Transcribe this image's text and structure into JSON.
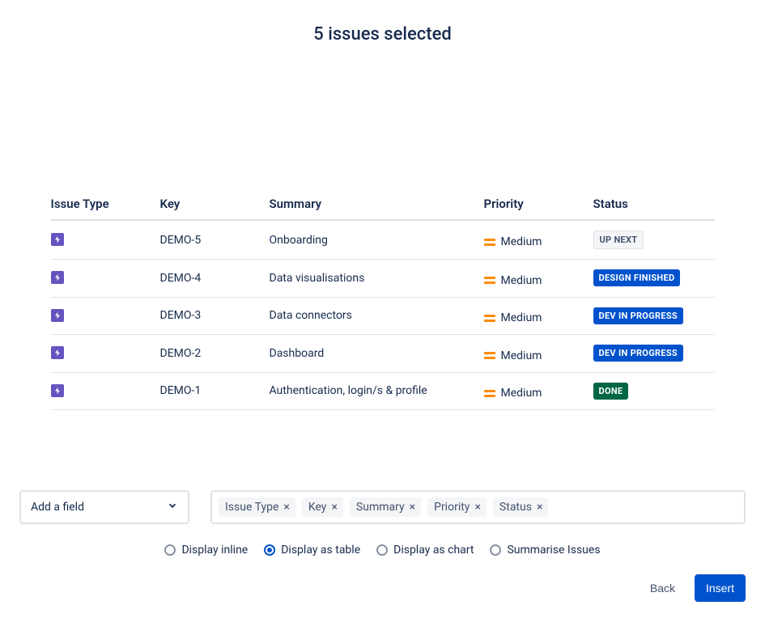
{
  "header": {
    "title": "5 issues selected"
  },
  "table": {
    "columns": {
      "issue_type": "Issue Type",
      "key": "Key",
      "summary": "Summary",
      "priority": "Priority",
      "status": "Status"
    },
    "rows": [
      {
        "type_icon": "epic-icon",
        "key": "DEMO-5",
        "summary": "Onboarding",
        "priority": "Medium",
        "status": "UP NEXT",
        "status_style": "neutral"
      },
      {
        "type_icon": "epic-icon",
        "key": "DEMO-4",
        "summary": "Data visualisations",
        "priority": "Medium",
        "status": "DESIGN FINISHED",
        "status_style": "blue"
      },
      {
        "type_icon": "epic-icon",
        "key": "DEMO-3",
        "summary": "Data connectors",
        "priority": "Medium",
        "status": "DEV IN PROGRESS",
        "status_style": "blue"
      },
      {
        "type_icon": "epic-icon",
        "key": "DEMO-2",
        "summary": "Dashboard",
        "priority": "Medium",
        "status": "DEV IN PROGRESS",
        "status_style": "blue"
      },
      {
        "type_icon": "epic-icon",
        "key": "DEMO-1",
        "summary": "Authentication, login/s & profile",
        "priority": "Medium",
        "status": "DONE",
        "status_style": "green"
      }
    ]
  },
  "add_field": {
    "label": "Add a field"
  },
  "field_chips": [
    "Issue Type",
    "Key",
    "Summary",
    "Priority",
    "Status"
  ],
  "display_options": [
    {
      "label": "Display inline",
      "selected": false
    },
    {
      "label": "Display as table",
      "selected": true
    },
    {
      "label": "Display as chart",
      "selected": false
    },
    {
      "label": "Summarise Issues",
      "selected": false
    }
  ],
  "actions": {
    "back": "Back",
    "insert": "Insert"
  }
}
